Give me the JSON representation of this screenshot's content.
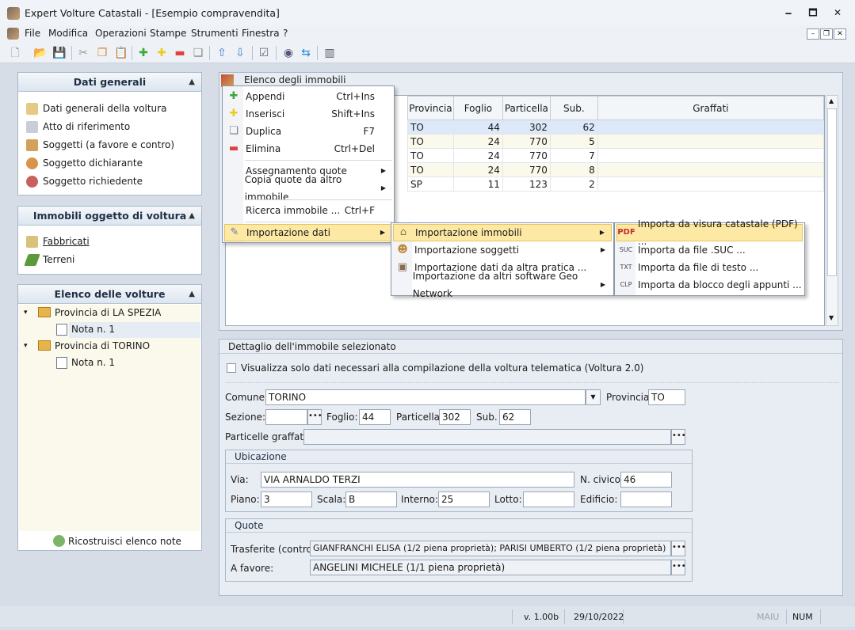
{
  "window": {
    "title": "Expert Volture Catastali - [Esempio compravendita]",
    "min": "🗕",
    "max": "🗖",
    "close": "✕"
  },
  "menubar": [
    "File",
    "Modifica",
    "Operazioni",
    "Stampe",
    "Strumenti",
    "Finestra",
    "?"
  ],
  "panels": {
    "dati_generali": {
      "title": "Dati generali",
      "items": [
        "Dati generali della voltura",
        "Atto di riferimento",
        "Soggetti (a favore e contro)",
        "Soggetto dichiarante",
        "Soggetto richiedente"
      ]
    },
    "immobili": {
      "title": "Immobili oggetto di voltura",
      "items": [
        "Fabbricati",
        "Terreni"
      ]
    },
    "volture": {
      "title": "Elenco delle volture",
      "tree": [
        {
          "label": "Provincia di LA SPEZIA",
          "child": "Nota n. 1"
        },
        {
          "label": "Provincia di TORINO",
          "child": "Nota n. 1"
        }
      ],
      "rebuild": "Ricostruisci elenco note"
    }
  },
  "immobili_list": {
    "title": "Elenco degli immobili",
    "columns": [
      "Provincia",
      "Foglio",
      "Particella",
      "Sub.",
      "Graffati"
    ],
    "rows": [
      [
        "TO",
        "44",
        "302",
        "62",
        ""
      ],
      [
        "TO",
        "24",
        "770",
        "5",
        ""
      ],
      [
        "TO",
        "24",
        "770",
        "7",
        ""
      ],
      [
        "TO",
        "24",
        "770",
        "8",
        ""
      ],
      [
        "SP",
        "11",
        "123",
        "2",
        ""
      ]
    ]
  },
  "context_menu": [
    {
      "label": "Appendi",
      "shortcut": "Ctrl+Ins",
      "icon": "plus-green-icon"
    },
    {
      "label": "Inserisci",
      "shortcut": "Shift+Ins",
      "icon": "plus-yellow-icon"
    },
    {
      "label": "Duplica",
      "shortcut": "F7",
      "icon": "duplicate-icon"
    },
    {
      "label": "Elimina",
      "shortcut": "Ctrl+Del",
      "icon": "minus-red-icon"
    },
    {
      "label": "Assegnamento quote",
      "submenu": true
    },
    {
      "label": "Copia quote da altro immobile",
      "submenu": true
    },
    {
      "label": "Ricerca immobile ...",
      "shortcut": "Ctrl+F"
    },
    {
      "label": "Importazione dati",
      "submenu": true,
      "icon": "import-icon"
    }
  ],
  "submenu1": [
    "Importazione immobili",
    "Importazione soggetti",
    "Importazione dati da altra pratica ...",
    "Importazione da altri software Geo Network"
  ],
  "submenu2": [
    "Importa da visura catastale (PDF) ...",
    "Importa da file .SUC ...",
    "Importa da file di testo ...",
    "Importa da blocco degli appunti ..."
  ],
  "dettaglio": {
    "title": "Dettaglio dell'immobile selezionato",
    "checkbox": "Visualizza solo dati necessari alla compilazione della voltura telematica (Voltura 2.0)",
    "comune_label": "Comune:",
    "comune": "TORINO",
    "provincia_label": "Provincia:",
    "provincia": "TO",
    "sezione_label": "Sezione:",
    "sezione": "",
    "foglio_label": "Foglio:",
    "foglio": "44",
    "particella_label": "Particella:",
    "particella": "302",
    "sub_label": "Sub.",
    "sub": "62",
    "graffate_label": "Particelle graffate:",
    "graffate": "",
    "ubicazione": {
      "title": "Ubicazione",
      "via_label": "Via:",
      "via": "VIA ARNALDO TERZI",
      "civico_label": "N. civico:",
      "civico": "46",
      "piano_label": "Piano:",
      "piano": "3",
      "scala_label": "Scala:",
      "scala": "B",
      "interno_label": "Interno:",
      "interno": "25",
      "lotto_label": "Lotto:",
      "lotto": "",
      "edificio_label": "Edificio:",
      "edificio": ""
    },
    "quote": {
      "title": "Quote",
      "contro_label": "Trasferite (contro):",
      "contro": "GIANFRANCHI ELISA (1/2 piena proprietà); PARISI UMBERTO (1/2 piena proprietà)",
      "favore_label": "A favore:",
      "favore": "ANGELINI MICHELE (1/1 piena proprietà)"
    }
  },
  "status": {
    "version": "v. 1.00b",
    "date": "29/10/2022",
    "maiu": "MAIU",
    "num": "NUM"
  },
  "colors": {
    "accent": "#fde9a4",
    "header": "#dce5ef",
    "selected_row": "#dde9f8"
  }
}
